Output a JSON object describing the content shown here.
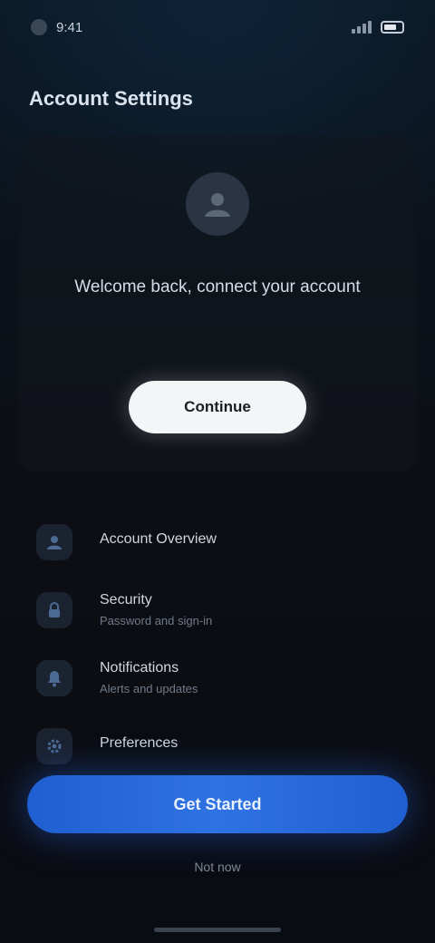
{
  "status_bar": {
    "time": "9:41"
  },
  "header": {
    "title": "Account Settings"
  },
  "hero": {
    "headline": "Welcome back, connect your account",
    "subline": "",
    "primary_button": "Continue"
  },
  "list": {
    "items": [
      {
        "title": "Account Overview",
        "subtitle": "",
        "icon": "user-icon"
      },
      {
        "title": "Security",
        "subtitle": "Password and sign-in",
        "icon": "lock-icon"
      },
      {
        "title": "Notifications",
        "subtitle": "Alerts and updates",
        "icon": "bell-icon"
      },
      {
        "title": "Preferences",
        "subtitle": "",
        "icon": "gear-icon"
      }
    ]
  },
  "footer": {
    "primary_button": "Get Started",
    "link": "Not now"
  },
  "colors": {
    "accent": "#2f72e2",
    "background": "#0c0d12"
  }
}
